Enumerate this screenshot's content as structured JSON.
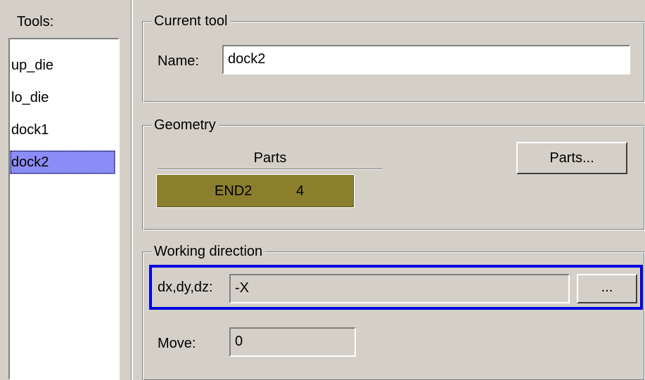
{
  "tools_panel": {
    "label": "Tools:",
    "items": [
      "up_die",
      "lo_die",
      "dock1",
      "dock2"
    ],
    "selected": "dock2"
  },
  "current_tool": {
    "legend": "Current tool",
    "name_label": "Name:",
    "name_value": "dock2"
  },
  "geometry": {
    "legend": "Geometry",
    "parts_header": "Parts",
    "parts_row": {
      "name": "END2",
      "count": "4"
    },
    "parts_button": "Parts..."
  },
  "working_direction": {
    "legend": "Working direction",
    "direction_label": "dx,dy,dz:",
    "direction_value": "-X",
    "browse_button": "...",
    "move_label": "Move:",
    "move_value": "0",
    "highlight_color": "#0000e0"
  },
  "colors": {
    "background": "#d4d0c8",
    "selection": "#8c8cf8",
    "parts_row_bg": "#8b7f2e"
  }
}
